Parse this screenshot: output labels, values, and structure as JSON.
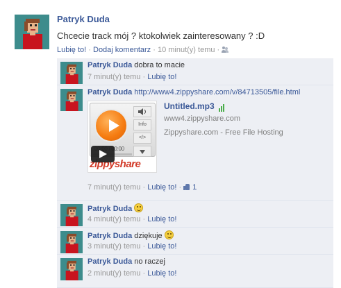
{
  "post": {
    "author": "Patryk Duda",
    "text": "Chcecie track mój ? ktokolwiek zainteresowany ? :D",
    "like_label": "Lubię to!",
    "comment_label": "Dodaj komentarz",
    "time": "10 minut(y) temu",
    "separator": "·",
    "audience_icon": "people-icon"
  },
  "comments": [
    {
      "author": "Patryk Duda",
      "text": "dobra to macie",
      "time": "7 minut(y) temu",
      "like_label": "Lubię to!"
    },
    {
      "author": "Patryk Duda",
      "text": "http://www4.zippyshare.com/v/84713505/file.html",
      "time": "7 minut(y) temu",
      "like_label": "Lubię to!",
      "like_count": "1",
      "attachment": {
        "title": "Untitled.mp3",
        "caption": "www4.zippyshare.com",
        "description": "Zippyshare.com - Free File Hosting",
        "player_time": "00:00 / 00:00",
        "player_info_label": "Info",
        "player_embed_label": "</>",
        "brand_text": "zippyshare",
        "signal_bars": 3
      }
    },
    {
      "author": "Patryk Duda",
      "text": "",
      "emoticon": "smile-emoji",
      "time": "4 minut(y) temu",
      "like_label": "Lubię to!"
    },
    {
      "author": "Patryk Duda",
      "text": "dziękuje",
      "emoticon": "smile-emoji",
      "time": "3 minut(y) temu",
      "like_label": "Lubię to!"
    },
    {
      "author": "Patryk Duda",
      "text": "no raczej",
      "time": "2 minut(y) temu",
      "like_label": "Lubię to!"
    }
  ],
  "colors": {
    "link": "#3b5998",
    "meta": "#999999",
    "comment_bg": "#edeff4",
    "zippy_orange": "#f57b10",
    "zippy_red": "#d23a28",
    "bars_green": "#4cae4c"
  }
}
